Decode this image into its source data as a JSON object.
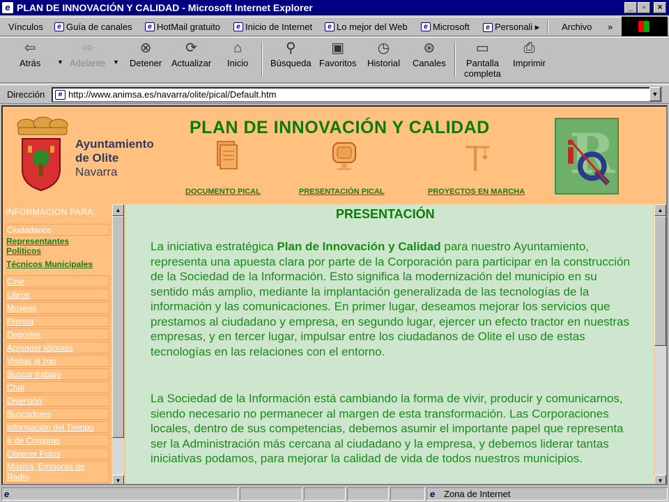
{
  "window": {
    "title": "PLAN DE INNOVACIÓN Y CALIDAD - Microsoft Internet Explorer",
    "min_glyph": "_",
    "max_glyph": "▫",
    "close_glyph": "×"
  },
  "links_bar": {
    "label": "Vínculos",
    "items": [
      "Guía de canales",
      "HotMail gratuito",
      "Inicio de Internet",
      "Lo mejor del Web",
      "Microsoft",
      "Personali ▸"
    ],
    "archivo": "Archivo",
    "more": "»"
  },
  "toolbar": {
    "back": "Atrás",
    "forward": "Adelante",
    "stop": "Detener",
    "refresh": "Actualizar",
    "home": "Inicio",
    "search": "Búsqueda",
    "favorites": "Favoritos",
    "history": "Historial",
    "channels": "Canales",
    "fullscreen_1": "Pantalla",
    "fullscreen_2": "completa",
    "print": "Imprimir"
  },
  "address": {
    "label": "Dirección",
    "url": "http://www.animsa.es/navarra/olite/pical/Default.htm"
  },
  "header": {
    "title": "PLAN DE INNOVACIÓN Y CALIDAD",
    "ayto_1": "Ayuntamiento",
    "ayto_2": "de Olite",
    "ayto_3": "Navarra",
    "nav": [
      "DOCUMENTO PICAL",
      "PRESENTACIÓN PICAL",
      "PROYECTOS EN MARCHA"
    ]
  },
  "sidebar": {
    "heading": "INFORMACIÓN PARA:",
    "ciudadanos": "Ciudadanos",
    "representantes_1": "Representantes",
    "representantes_2": "Políticos",
    "tecnicos": "Técnicos Municipales",
    "items": [
      "Cine",
      "Libros",
      "Museos",
      "Prensa",
      "Deportes",
      "Aprender Idiomas",
      "Visitas al zoo",
      "Buscar trabajo",
      "Chat",
      "Diversión",
      "Buscadores",
      "Información del Tiempo",
      "Ir de Compras",
      "Obtener Fotos"
    ],
    "last_1": "Música, Emisoras de",
    "last_2": "Radio"
  },
  "content": {
    "title": "PRESENTACIÓN",
    "p1_pre": "La iniciativa estratégica ",
    "p1_bold": "Plan de Innovación y Calidad",
    "p1_post": " para nuestro Ayuntamiento, representa una apuesta clara por parte de la Corporación para participar en la construcción de la Sociedad de la Información. Esto significa la modernización del municipio en su sentido más amplio, mediante la implantación generalizada de las tecnologías de la información y las comunicaciones. En primer lugar, deseamos mejorar los servicios que prestamos al ciudadano y empresa, en segundo lugar, ejercer un efecto tractor en nuestras empresas, y en tercer lugar, impulsar entre los ciudadanos de Olite el uso de estas tecnologías en las relaciones con el entorno.",
    "p2": "La Sociedad de la Información está cambiando la forma de vivir, producir y comunicarnos, siendo necesario no permanecer al margen de esta transformación. Las Corporaciones locales, dentro de sus competencias, debemos asumir el importante papel que representa ser la Administración más cercana al ciudadano y la empresa, y debemos liderar tantas iniciativas podamos, para mejorar la calidad de vida de todos nuestros municipios."
  },
  "status": {
    "zone": "Zona de Internet"
  }
}
